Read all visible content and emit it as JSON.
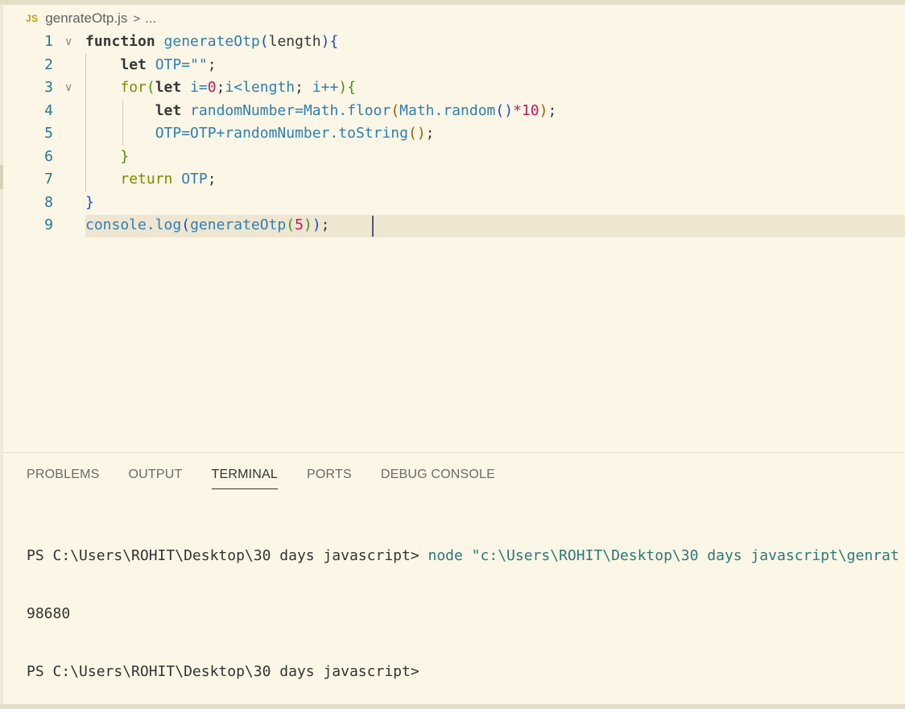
{
  "breadcrumb": {
    "file_icon_text": "JS",
    "file_name": "genrateOtp.js",
    "separator": ">",
    "rest": "..."
  },
  "editor": {
    "line_numbers": [
      "1",
      "2",
      "3",
      "4",
      "5",
      "6",
      "7",
      "8",
      "9"
    ],
    "lines": [
      [
        {
          "t": "function ",
          "c": "kb"
        },
        {
          "t": "generateOtp",
          "c": "fn"
        },
        {
          "t": "(",
          "c": "b1"
        },
        {
          "t": "length",
          "c": "txt"
        },
        {
          "t": "){",
          "c": "b1"
        }
      ],
      [
        {
          "t": "    "
        },
        {
          "t": "let ",
          "c": "kb"
        },
        {
          "t": "OTP=",
          "c": "var"
        },
        {
          "t": "\"\"",
          "c": "str"
        },
        {
          "t": ";",
          "c": "txt"
        }
      ],
      [
        {
          "t": "    "
        },
        {
          "t": "for",
          "c": "ctl"
        },
        {
          "t": "(",
          "c": "b2"
        },
        {
          "t": "let ",
          "c": "kb"
        },
        {
          "t": "i=",
          "c": "var"
        },
        {
          "t": "0",
          "c": "num"
        },
        {
          "t": ";",
          "c": "txt"
        },
        {
          "t": "i<length",
          "c": "var"
        },
        {
          "t": "; ",
          "c": "txt"
        },
        {
          "t": "i++",
          "c": "var"
        },
        {
          "t": "){",
          "c": "b2"
        }
      ],
      [
        {
          "t": "        "
        },
        {
          "t": "let ",
          "c": "kb"
        },
        {
          "t": "randomNumber=Math.floor",
          "c": "var"
        },
        {
          "t": "(",
          "c": "b3"
        },
        {
          "t": "Math.random",
          "c": "var"
        },
        {
          "t": "()",
          "c": "b1"
        },
        {
          "t": "*",
          "c": "num"
        },
        {
          "t": "10",
          "c": "num"
        },
        {
          "t": ")",
          "c": "b3"
        },
        {
          "t": ";",
          "c": "txt"
        }
      ],
      [
        {
          "t": "        "
        },
        {
          "t": "OTP=OTP+randomNumber.toString",
          "c": "var"
        },
        {
          "t": "()",
          "c": "b3"
        },
        {
          "t": ";",
          "c": "txt"
        }
      ],
      [
        {
          "t": "    "
        },
        {
          "t": "}",
          "c": "b2"
        }
      ],
      [
        {
          "t": "    "
        },
        {
          "t": "return ",
          "c": "ctl"
        },
        {
          "t": "OTP",
          "c": "var"
        },
        {
          "t": ";",
          "c": "txt"
        }
      ],
      [
        {
          "t": "}",
          "c": "b1"
        }
      ],
      [
        {
          "t": "console.log",
          "c": "var"
        },
        {
          "t": "(",
          "c": "b1"
        },
        {
          "t": "generateOtp",
          "c": "var"
        },
        {
          "t": "(",
          "c": "b2"
        },
        {
          "t": "5",
          "c": "num"
        },
        {
          "t": ")",
          "c": "b2"
        },
        {
          "t": ")",
          "c": "b1"
        },
        {
          "t": ";",
          "c": "txt"
        }
      ]
    ],
    "folded_lines": [
      1,
      3
    ],
    "current_line": 9
  },
  "panel": {
    "tabs": [
      "PROBLEMS",
      "OUTPUT",
      "TERMINAL",
      "PORTS",
      "DEBUG CONSOLE"
    ],
    "active_tab": "TERMINAL",
    "terminal": {
      "prompt1": "PS C:\\Users\\ROHIT\\Desktop\\30 days javascript> ",
      "command1": "node \"c:\\Users\\ROHIT\\Desktop\\30 days javascript\\genrat",
      "output": "98680",
      "prompt2": "PS C:\\Users\\ROHIT\\Desktop\\30 days javascript>"
    }
  },
  "colors": {
    "editor_background": "#fbf6e5",
    "line_number": "#237893",
    "keyword": "#383838",
    "identifier": "#2f7fb3",
    "number": "#c2185b",
    "control": "#7d8b00"
  }
}
